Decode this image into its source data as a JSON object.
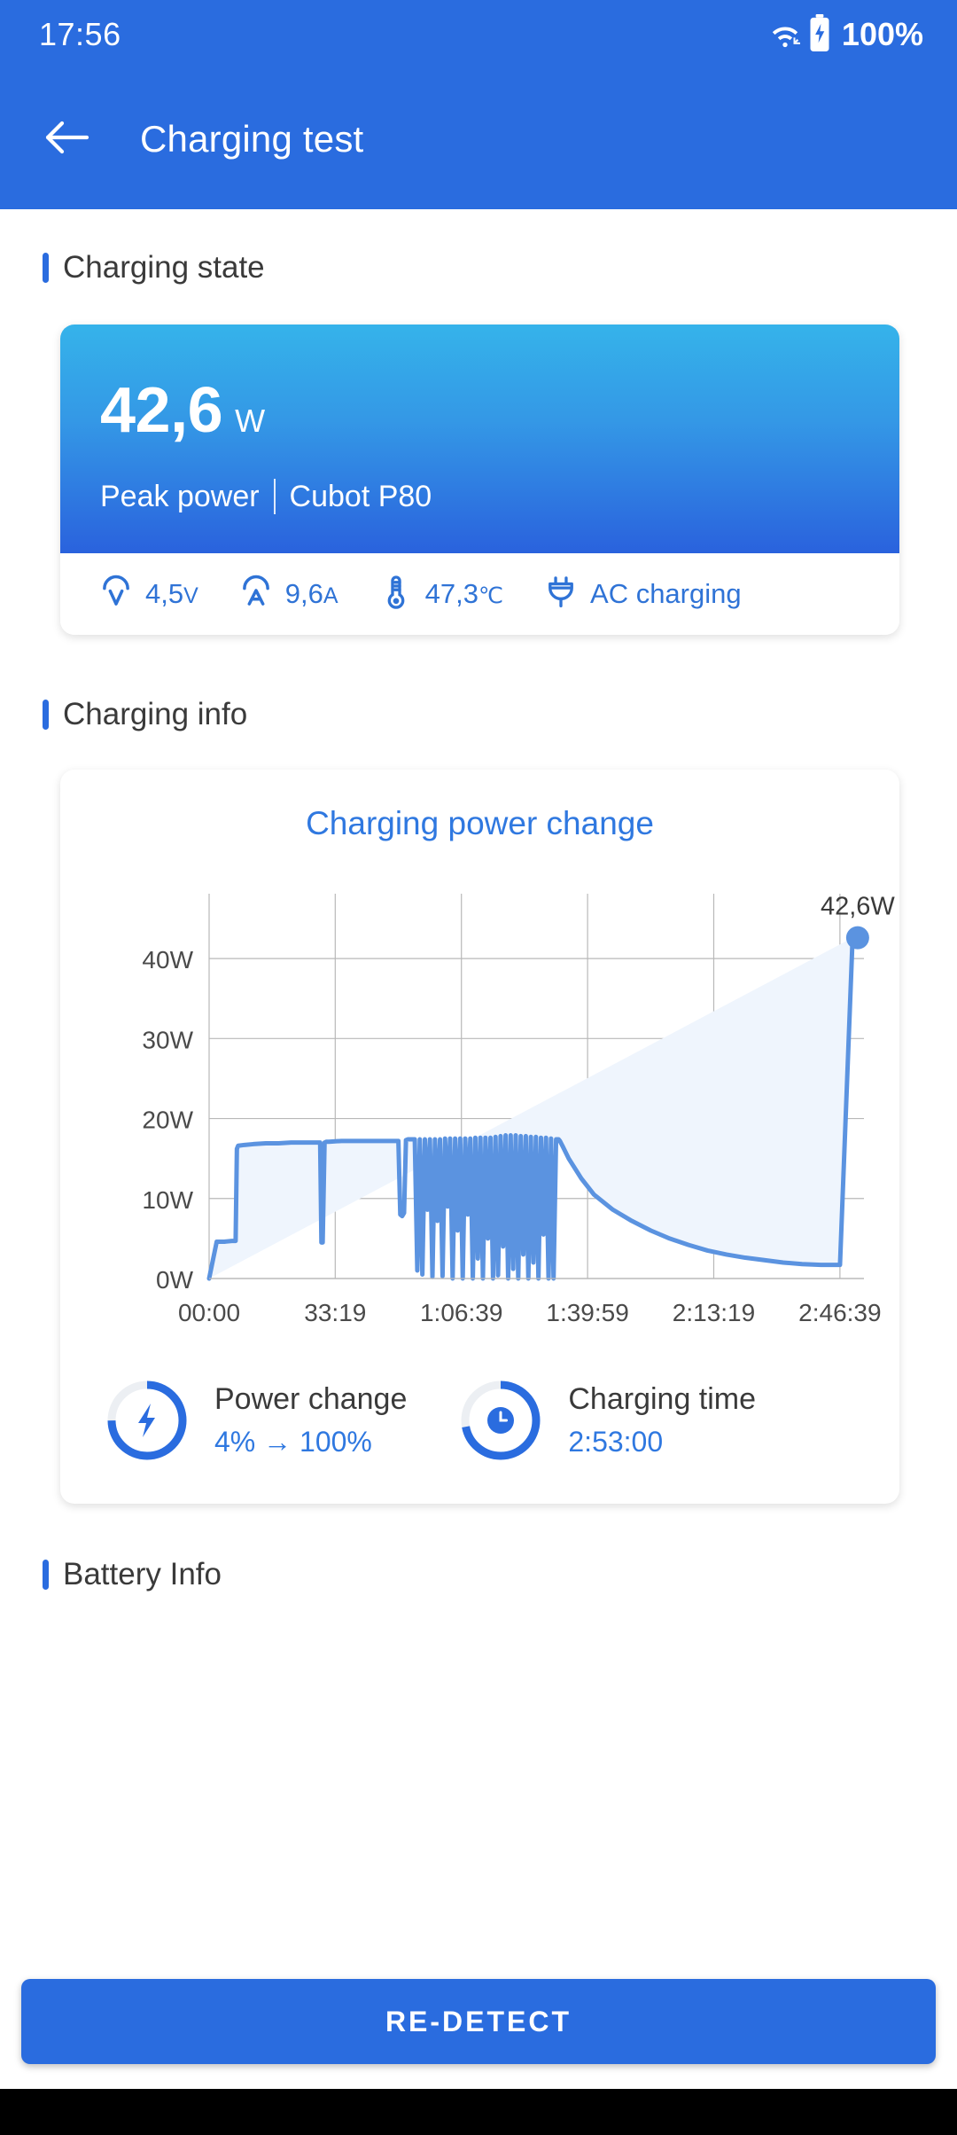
{
  "status_bar": {
    "time": "17:56",
    "battery_percent": "100%",
    "wifi_icon": "wifi-icon",
    "battery_icon": "battery-charging-icon"
  },
  "app_bar": {
    "back_icon": "arrow-left-icon",
    "title": "Charging test"
  },
  "sections": {
    "charging_state": "Charging state",
    "charging_info": "Charging info",
    "battery_info": "Battery Info"
  },
  "charging_state_card": {
    "peak_value": "42,6",
    "peak_unit": "W",
    "caption_label": "Peak power",
    "device_name": "Cubot P80",
    "stats": [
      {
        "icon": "voltage-icon",
        "value": "4,5",
        "unit": "V"
      },
      {
        "icon": "current-icon",
        "value": "9,6",
        "unit": "A"
      },
      {
        "icon": "thermometer-icon",
        "value": "47,3",
        "unit": "℃"
      },
      {
        "icon": "plug-icon",
        "value": "AC charging",
        "unit": ""
      }
    ]
  },
  "chart_card": {
    "title": "Charging power change",
    "peak_annotation": "42,6W",
    "footer": [
      {
        "icon": "bolt-icon",
        "label": "Power change",
        "value": "4% → 100%",
        "ring_percent": 75
      },
      {
        "icon": "clock-icon",
        "label": "Charging time",
        "value": "2:53:00",
        "ring_percent": 72
      }
    ]
  },
  "chart_data": {
    "type": "area",
    "title": "Charging power change",
    "xlabel": "",
    "ylabel": "",
    "ylim": [
      0,
      45
    ],
    "xlim": [
      0,
      10380
    ],
    "grid": true,
    "legend": null,
    "line_color": "#5b93e0",
    "fill_color": "#eff5fd",
    "ytick_labels": [
      "0W",
      "10W",
      "20W",
      "30W",
      "40W"
    ],
    "ytick_values": [
      0,
      10,
      20,
      30,
      40
    ],
    "xtick_labels": [
      "00:00",
      "33:19",
      "1:06:39",
      "1:39:59",
      "2:13:19",
      "2:46:39"
    ],
    "xtick_values": [
      0,
      1999,
      3999,
      5999,
      7999,
      9999
    ],
    "annotation": {
      "text": "42,6W",
      "x": 10280,
      "y": 42.6,
      "marker": "dot"
    },
    "series": [
      {
        "name": "Charging power",
        "x": [
          0,
          120,
          240,
          360,
          420,
          440,
          460,
          560,
          700,
          900,
          1100,
          1300,
          1500,
          1700,
          1760,
          1780,
          1800,
          1830,
          1860,
          1900,
          2100,
          2300,
          2500,
          2700,
          2900,
          3000,
          3030,
          3060,
          3090,
          3120,
          3150,
          3200,
          3260,
          3300,
          3340,
          3380,
          3420,
          3460,
          3500,
          3540,
          3580,
          3620,
          3660,
          3700,
          3740,
          3780,
          3820,
          3860,
          3900,
          3940,
          3980,
          4020,
          4060,
          4100,
          4140,
          4180,
          4220,
          4260,
          4300,
          4340,
          4380,
          4420,
          4460,
          4500,
          4540,
          4580,
          4620,
          4660,
          4700,
          4740,
          4780,
          4820,
          4860,
          4900,
          4940,
          4980,
          5020,
          5060,
          5100,
          5140,
          5180,
          5220,
          5260,
          5300,
          5340,
          5380,
          5420,
          5460,
          5500,
          5540,
          5560,
          5600,
          5700,
          5900,
          6100,
          6400,
          6700,
          7000,
          7300,
          7600,
          7900,
          8200,
          8500,
          8800,
          9100,
          9400,
          9700,
          10000,
          10200,
          10260,
          10280
        ],
        "y": [
          0,
          4.6,
          4.6,
          4.7,
          4.7,
          16.2,
          16.6,
          16.7,
          16.8,
          16.9,
          16.9,
          17.0,
          17.0,
          17.0,
          17.0,
          4.5,
          4.5,
          17.0,
          17.1,
          17.1,
          17.2,
          17.2,
          17.2,
          17.2,
          17.2,
          17.2,
          8.0,
          7.8,
          8.2,
          17.3,
          17.4,
          17.4,
          17.4,
          1.0,
          17.4,
          0.5,
          17.4,
          8.6,
          17.4,
          0.2,
          17.4,
          7.2,
          17.4,
          0.3,
          17.5,
          9.0,
          17.5,
          0.0,
          17.5,
          6.0,
          17.5,
          0.0,
          17.5,
          8.0,
          17.5,
          0.0,
          17.6,
          2.5,
          17.6,
          0.0,
          17.6,
          5.0,
          17.6,
          0.0,
          17.7,
          0.4,
          17.8,
          4.0,
          17.9,
          0.0,
          17.9,
          1.2,
          17.9,
          0.0,
          17.8,
          3.0,
          17.8,
          0.0,
          17.7,
          2.0,
          17.7,
          0.0,
          17.6,
          5.5,
          17.6,
          0.0,
          17.5,
          0.0,
          17.4,
          17.4,
          17.2,
          16.6,
          15.0,
          12.5,
          10.5,
          8.6,
          7.2,
          6.0,
          5.0,
          4.2,
          3.5,
          3.0,
          2.6,
          2.3,
          2.0,
          1.8,
          1.7,
          1.7,
          42.6
        ]
      }
    ]
  },
  "redetect_button": {
    "label": "RE-DETECT"
  },
  "colors": {
    "primary": "#2a6cdf",
    "accent": "#2f78e0",
    "chart_line": "#5b93e0",
    "chart_fill": "#eff5fd",
    "hero_gradient_start": "#35b3ea",
    "hero_gradient_end": "#2a62dd",
    "text_dark": "#3a3a3a"
  }
}
